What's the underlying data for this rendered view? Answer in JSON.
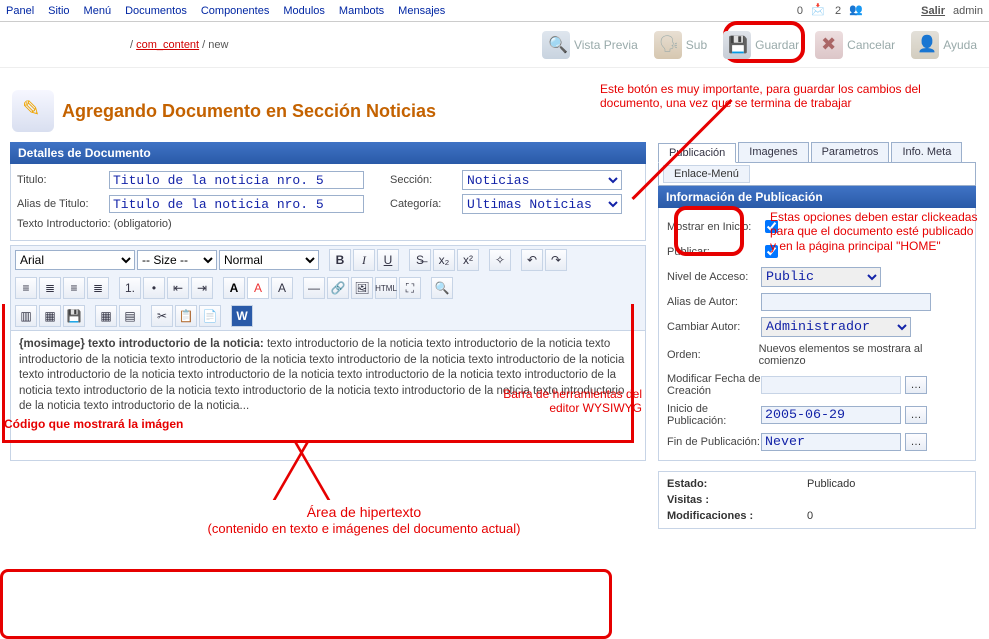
{
  "topmenu": [
    "Panel",
    "Sitio",
    "Menú",
    "Documentos",
    "Componentes",
    "Modulos",
    "Mambots",
    "Mensajes"
  ],
  "topbar": {
    "msgcount": "0",
    "usercount": "2",
    "logout": "Salir",
    "user": "admin"
  },
  "breadcrumb": {
    "link": "com_content",
    "suffix": " / new",
    "prefix": "/ "
  },
  "actions": {
    "preview": "Vista Previa",
    "sub": "Sub",
    "save": "Guardar",
    "cancel": "Cancelar",
    "help": "Ayuda"
  },
  "annotations": {
    "save": "Este botón es muy importante, para guardar los cambios del documento, una vez que se termina de trabajar",
    "chk": "Estas opciones deben estar clickeadas para que el documento esté publicado y en la página principal \"HOME\"",
    "toolbar": "Barra de herramientas del editor WYSIWYG",
    "imgcode": "Código que mostrará la imágen",
    "area_t": "Área de hipertexto",
    "area_s": "(contenido en texto e imágenes del documento actual)"
  },
  "page": {
    "title": "Agregando Documento en Sección Noticias"
  },
  "leftpanel": {
    "bar": "Detalles de Documento",
    "labels": {
      "titulo": "Titulo:",
      "alias": "Alias de Titulo:",
      "seccion": "Sección:",
      "categoria": "Categoría:",
      "intro": "Texto Introductorio: (obligatorio)"
    },
    "values": {
      "titulo": "Titulo de la noticia nro. 5",
      "alias": "Titulo de la noticia nro. 5",
      "seccion": "Noticias",
      "categoria": "Ultimas Noticias"
    }
  },
  "editor": {
    "font": "Arial",
    "size": "-- Size --",
    "format": "Normal",
    "mosimage": "{mosimage}",
    "lead": "texto introductorio de la noticia:",
    "body": "texto introductorio de la noticia texto introductorio de la noticia texto introductorio de la noticia texto introductorio de la noticia texto introductorio de la noticia texto introductorio de la noticia texto introductorio de la noticia texto introductorio de la noticia texto introductorio de la noticia texto introductorio de la noticia texto introductorio de la noticia texto introductorio de la noticia texto introductorio de la noticia texto introductorio de la noticia texto introductorio de la noticia..."
  },
  "tabs": [
    "Publicación",
    "Imagenes",
    "Parametros",
    "Info. Meta"
  ],
  "subtab": "Enlace-Menú",
  "pub": {
    "bar": "Información de Publicación",
    "labels": {
      "mostrar": "Mostrar en Inicio:",
      "publicar": "Publicar:",
      "nivel": "Nivel de Acceso:",
      "aliasautor": "Alias de Autor:",
      "cambiar": "Cambiar Autor:",
      "orden": "Orden:",
      "orden_note": "Nuevos elementos se mostrara al comienzo",
      "modfc": "Modificar Fecha de Creación",
      "inicio": "Inicio de Publicación:",
      "fin": "Fin de Publicación:"
    },
    "values": {
      "nivel": "Public",
      "cambiar": "Administrador",
      "inicio": "2005-06-29",
      "fin": "Never"
    }
  },
  "status": {
    "labels": {
      "estado": "Estado:",
      "visitas": "Visitas :",
      "mods": "Modificaciones :"
    },
    "values": {
      "estado": "Publicado",
      "mods": "0"
    }
  }
}
